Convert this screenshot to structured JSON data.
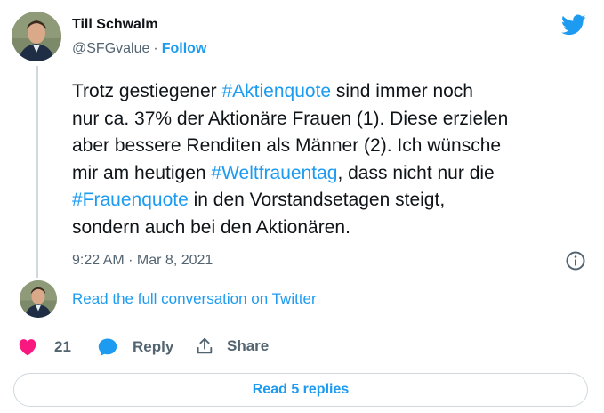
{
  "author": {
    "name": "Till Schwalm",
    "handle": "@SFGvalue",
    "separator": "·",
    "follow_label": "Follow"
  },
  "tweet": {
    "lines": [
      [
        {
          "t": "Trotz gestiegener "
        },
        {
          "t": "#Aktienquote",
          "tag": true
        },
        {
          "t": " sind immer noch"
        }
      ],
      [
        {
          "t": "nur ca. 37% der Aktionäre Frauen (1). Diese erzielen"
        }
      ],
      [
        {
          "t": "aber bessere Renditen als Männer (2). Ich wünsche"
        }
      ],
      [
        {
          "t": "mir am heutigen "
        },
        {
          "t": "#Weltfrauentag",
          "tag": true
        },
        {
          "t": ", dass nicht nur die"
        }
      ],
      [
        {
          "t": "#Frauenquote",
          "tag": true
        },
        {
          "t": " in den Vorstandsetagen steigt,"
        }
      ],
      [
        {
          "t": "sondern auch bei den Aktionären."
        }
      ]
    ],
    "timestamp": "9:22 AM · Mar 8, 2021"
  },
  "conversation_link": "Read the full conversation on Twitter",
  "actions": {
    "like_count": "21",
    "reply_label": "Reply",
    "share_label": "Share"
  },
  "read_replies_label": "Read 5 replies",
  "colors": {
    "accent": "#1d9bf0",
    "like": "#f91880",
    "text": "#0f1419",
    "secondary": "#536471",
    "border": "#cfd9de"
  },
  "icons": [
    "twitter-bird-icon",
    "info-icon",
    "heart-icon",
    "reply-bubble-icon",
    "share-icon"
  ]
}
